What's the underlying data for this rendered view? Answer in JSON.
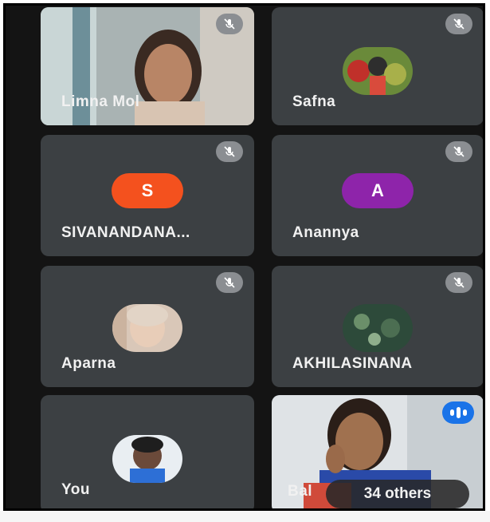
{
  "participants": [
    {
      "name": "Limna Mol",
      "muted": true,
      "video": true
    },
    {
      "name": "Safna",
      "muted": true,
      "avatar": "photo"
    },
    {
      "name": "SIVANANDANA...",
      "muted": true,
      "initial": "S",
      "color": "#f4511e"
    },
    {
      "name": "Anannya",
      "muted": true,
      "initial": "A",
      "color": "#8e24aa"
    },
    {
      "name": "Aparna",
      "muted": true,
      "avatar": "photo"
    },
    {
      "name": "AKHILASINANA",
      "muted": true,
      "avatar": "photo"
    },
    {
      "name": "You",
      "muted": false,
      "avatar": "photo"
    },
    {
      "name": "Bal",
      "speaking": true,
      "video": true
    }
  ],
  "others_label": "34 others",
  "icons": {
    "mute": "mic-off-icon",
    "speaking": "audio-level-icon"
  },
  "colors": {
    "tile": "#3c4043",
    "background": "#141414",
    "speaking": "#1a73e8"
  }
}
